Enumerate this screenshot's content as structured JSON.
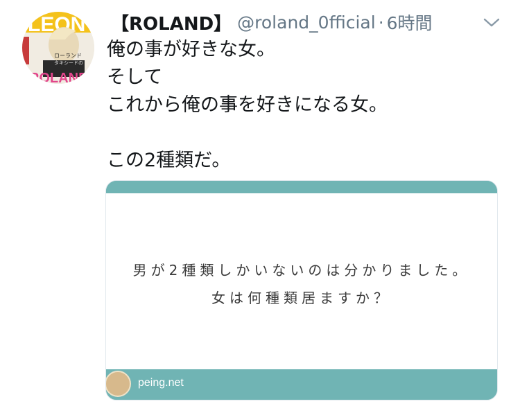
{
  "tweet": {
    "author_name": "【ROLAND】",
    "handle": "@roland_0fficial",
    "separator": "·",
    "time": "6時間",
    "lines": [
      "俺の事が好きな女。",
      "そして",
      "これから俺の事を好きになる女。",
      "",
      "この2種類だ。"
    ]
  },
  "avatar": {
    "magazine_logo": "LEON",
    "cover_text_1": "ローランド",
    "cover_text_2": "タキシードの",
    "bottom_text": "ROLAND"
  },
  "card": {
    "question_line_1": "男が2種類しかいないのは分かりました。",
    "question_line_2": "女は何種類居ますか？",
    "domain": "peing.net",
    "accent_color": "#70b4b4"
  },
  "icons": {
    "more": "chevron-down-icon",
    "card_logo": "peing-logo-icon"
  }
}
